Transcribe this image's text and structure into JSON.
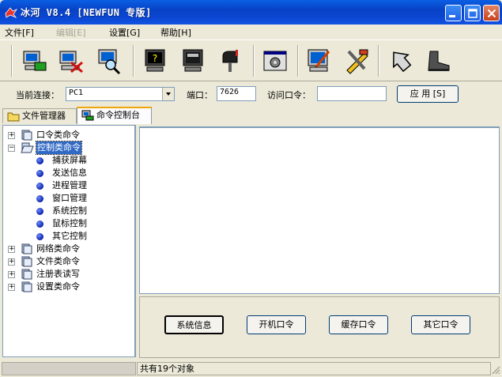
{
  "window": {
    "title": "冰河 V8.4 [NEWFUN 专版]"
  },
  "menu": {
    "items": [
      {
        "label": "文件[F]"
      },
      {
        "label": "编辑[E]"
      },
      {
        "label": "设置[G]"
      },
      {
        "label": "帮助[H]"
      }
    ]
  },
  "toolbar": {
    "icons": [
      "add-host-icon",
      "remove-host-icon",
      "search-host-icon",
      "help-icon",
      "monitor-screen-icon",
      "mailbox-icon",
      "config-icon",
      "edit-server-icon",
      "tools-icon",
      "back-icon",
      "exit-boot-icon"
    ]
  },
  "connection": {
    "current_label": "当前连接：",
    "current_value": "PC1",
    "port_label": "端口：",
    "port_value": "7626",
    "password_label": "访问口令：",
    "password_value": "",
    "apply_label": "应 用 [S]"
  },
  "tabs": [
    {
      "label": "文件管理器"
    },
    {
      "label": "命令控制台"
    }
  ],
  "tree": {
    "groups": [
      {
        "label": "口令类命令"
      },
      {
        "label": "控制类命令",
        "children": [
          "捕获屏幕",
          "发送信息",
          "进程管理",
          "窗口管理",
          "系统控制",
          "鼠标控制",
          "其它控制"
        ]
      },
      {
        "label": "网络类命令"
      },
      {
        "label": "文件类命令"
      },
      {
        "label": "注册表读写"
      },
      {
        "label": "设置类命令"
      }
    ]
  },
  "commands": {
    "buttons": [
      {
        "label": "系统信息"
      },
      {
        "label": "开机口令"
      },
      {
        "label": "缓存口令"
      },
      {
        "label": "其它口令"
      }
    ]
  },
  "status": {
    "left": "",
    "right": "共有19个对象"
  }
}
